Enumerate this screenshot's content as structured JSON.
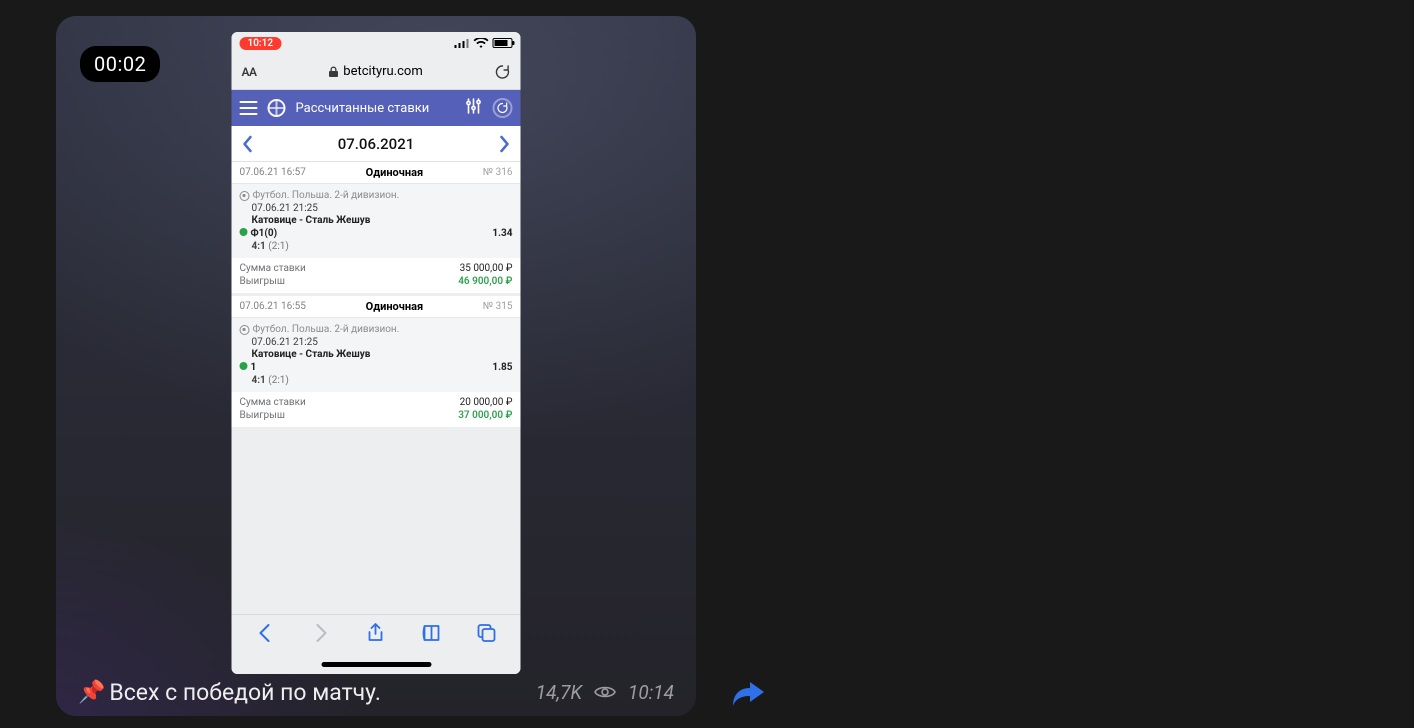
{
  "message": {
    "duration_badge": "00:02",
    "caption_pin_emoji": "📌",
    "caption_text": "Всех с победой по матчу.",
    "views": "14,7K",
    "time": "10:14"
  },
  "phone": {
    "status_time_rec": "10:12",
    "url_host": "betcityru.com",
    "aA_label": "AA",
    "app_header_title": "Рассчитанные ставки",
    "date_nav": "07.06.2021",
    "stake_label": "Сумма ставки",
    "payout_label": "Выигрыш",
    "bets": [
      {
        "hdr_time": "07.06.21 16:57",
        "hdr_type": "Одиночная",
        "hdr_num": "№ 316",
        "league": "Футбол. Польша. 2-й дивизион.",
        "match_dt": "07.06.21 21:25",
        "match_name": "Катовице - Сталь Жешув",
        "pick": "Ф1(0)",
        "coef": "1.34",
        "score_main": "4:1",
        "score_sub": "(2:1)",
        "stake": "35 000,00 ₽",
        "payout": "46 900,00 ₽"
      },
      {
        "hdr_time": "07.06.21 16:55",
        "hdr_type": "Одиночная",
        "hdr_num": "№ 315",
        "league": "Футбол. Польша. 2-й дивизион.",
        "match_dt": "07.06.21 21:25",
        "match_name": "Катовице - Сталь Жешув",
        "pick": "1",
        "coef": "1.85",
        "score_main": "4:1",
        "score_sub": "(2:1)",
        "stake": "20 000,00 ₽",
        "payout": "37 000,00 ₽"
      }
    ]
  }
}
